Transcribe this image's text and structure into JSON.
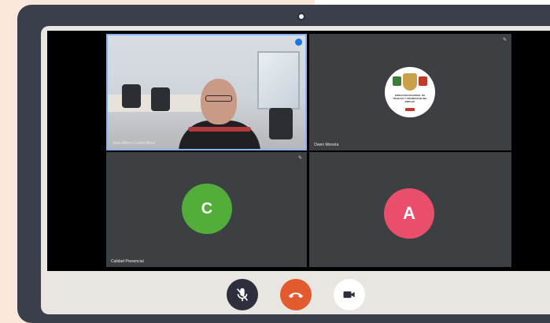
{
  "meeting": {
    "participants": [
      {
        "name": "Jose Alfaro Cortes Mora",
        "type": "video",
        "speaking": true
      },
      {
        "name": "Owen Moreira",
        "type": "logo",
        "logo_text": "DIRECCION REGIONAL DE TRABAJO Y PROMOCION DEL EMPLEO"
      },
      {
        "name": "Calidad Presencial",
        "type": "avatar",
        "initial": "C",
        "color": "#52ad3a"
      },
      {
        "name": "",
        "type": "avatar",
        "initial": "A",
        "color": "#e94f6b"
      }
    ]
  },
  "controls": {
    "mic": {
      "icon": "microphone-muted-icon",
      "state": "muted"
    },
    "hangup": {
      "icon": "phone-hangup-icon"
    },
    "camera": {
      "icon": "video-camera-icon",
      "state": "on"
    }
  },
  "colors": {
    "frame": "#3b3f4c",
    "tile": "#3d4043",
    "speaking_border": "#8ab4f8",
    "hangup": "#e15b2e",
    "mic_button": "#2d2f3d"
  }
}
